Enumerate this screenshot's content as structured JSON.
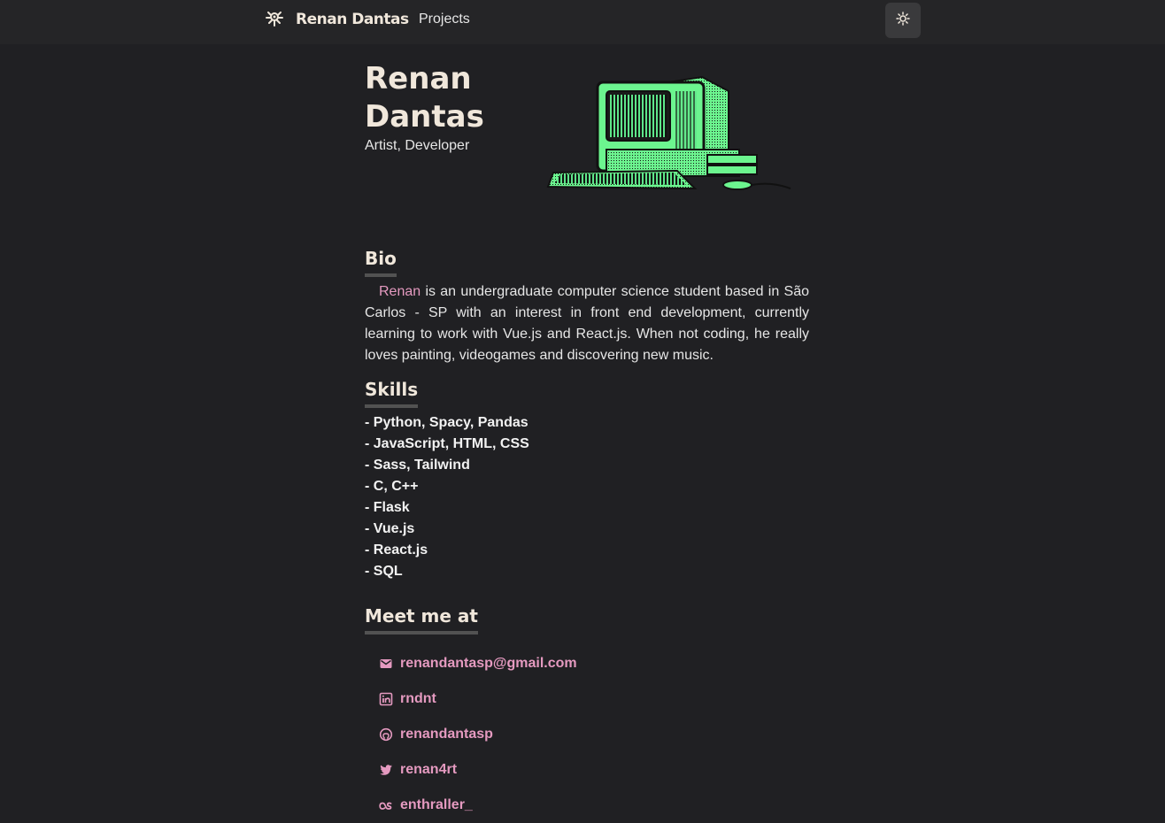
{
  "navbar": {
    "brand_name": "Renan Dantas",
    "brand_icon": "footprint-icon",
    "links": [
      "Projects"
    ],
    "theme_toggle_icon": "sun-icon"
  },
  "hero": {
    "name": "Renan Dantas",
    "subtitle": "Artist, Developer",
    "image": "retro-computer-illustration"
  },
  "bio": {
    "title": "Bio",
    "name_link": "Renan",
    "text": "is an undergraduate computer science student based in São Carlos - SP with an interest in front end development, currently learning to work with Vue.js and React.js. When not coding, he really loves painting, videogames and discovering new music."
  },
  "skills": {
    "title": "Skills",
    "items": [
      "- Python, Spacy, Pandas",
      "- JavaScript, HTML, CSS",
      "- Sass, Tailwind",
      "- C, C++",
      "- Flask",
      "- Vue.js",
      "- React.js",
      "- SQL"
    ]
  },
  "contact": {
    "title": "Meet me at",
    "items": [
      {
        "icon": "email-icon",
        "label": "renandantasp@gmail.com"
      },
      {
        "icon": "linkedin-icon",
        "label": "rndnt"
      },
      {
        "icon": "github-icon",
        "label": "renandantasp"
      },
      {
        "icon": "twitter-icon",
        "label": "renan4rt"
      },
      {
        "icon": "lastfm-icon",
        "label": "enthraller_"
      }
    ]
  },
  "colors": {
    "background": "#202023",
    "accent": "#e59ac0",
    "heading": "#f0e7db",
    "screen_green": "#6cf58f"
  }
}
